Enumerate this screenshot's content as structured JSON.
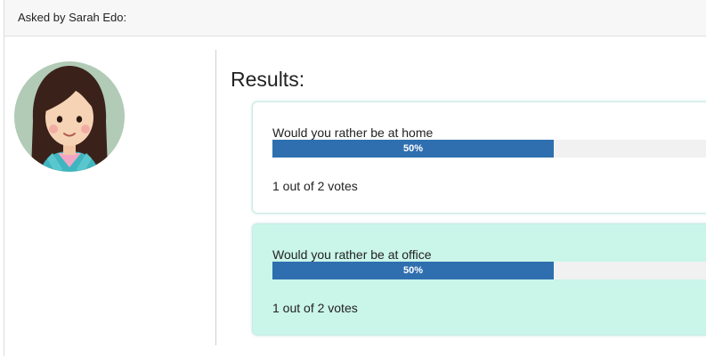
{
  "poll": {
    "asked_by": "Asked by Sarah Edo:",
    "avatar_icon": "girl-avatar-icon",
    "results_title": "Results:",
    "options": [
      {
        "text": "Would you rather be at home",
        "percent_label": "50%",
        "percent": 50,
        "votes_text": "1 out of 2 votes",
        "selected": false
      },
      {
        "text": "Would you rather be at office",
        "percent_label": "50%",
        "percent": 50,
        "votes_text": "1 out of 2 votes",
        "selected": true
      }
    ]
  },
  "colors": {
    "progress_fill": "#2f6fb0",
    "selected_background": "#caf5e9",
    "avatar_background": "#b1cbb6"
  }
}
